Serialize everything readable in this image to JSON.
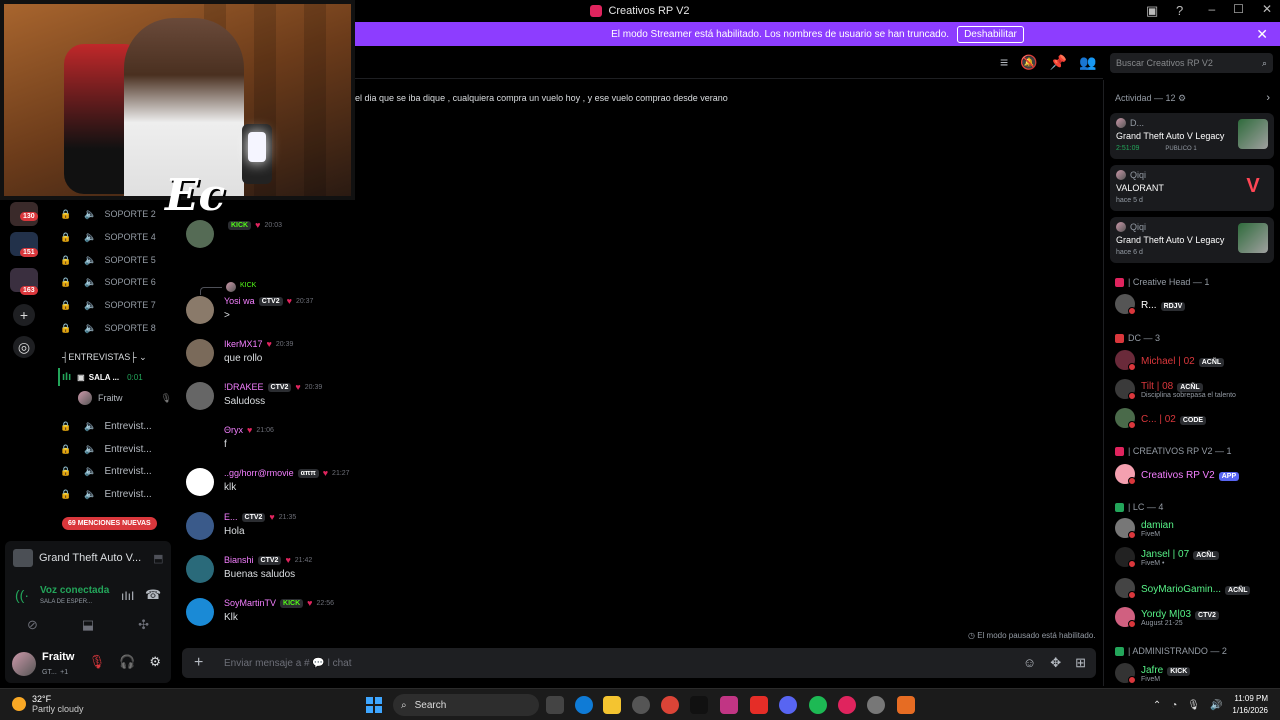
{
  "window": {
    "title": "Creativos RP V2"
  },
  "banner": {
    "text": "El modo Streamer está habilitado. Los nombres de usuario se han truncado.",
    "button": "Deshabilitar"
  },
  "rail": {
    "badges": [
      "130",
      "151",
      "163"
    ]
  },
  "channels": {
    "support": [
      "SOPORTE 2",
      "SOPORTE 4",
      "SOPORTE 5",
      "SOPORTE 6",
      "SOPORTE 7",
      "SOPORTE 8"
    ],
    "category": "ENTREVISTAS",
    "active_voice": "SALA ...",
    "active_voice_time": "0:01",
    "voice_user": "Fraitw",
    "entrevistas": [
      "Entrevist...",
      "Entrevist...",
      "Entrevist...",
      "Entrevist..."
    ],
    "mentions": "69 MENCIONES NUEVAS"
  },
  "user_panel": {
    "game": "Grand Theft Auto V...",
    "voice_status": "Voz conectada",
    "voice_sub": "SALA DE ESPER...",
    "username": "Fraitw",
    "user_status": "GT...",
    "user_extra": "+1"
  },
  "search": {
    "placeholder": "Buscar Creativos RP V2"
  },
  "chat": {
    "top_message": "el dia que se iba dique , cualquiera compra un vuelo hoy , y ese vuelo comprao desde verano",
    "reply_ref": "KICK",
    "messages": [
      {
        "author": "",
        "badge": "KICK",
        "badge_kind": "kick",
        "time": "20:03",
        "text": "",
        "author_color": "#dbdee1"
      },
      {
        "author": "Yosi wa",
        "badge": "CTV2",
        "badge_kind": "ctv2",
        "time": "20:37",
        "text": ">",
        "author_color": "#f47fff"
      },
      {
        "author": "IkerMX17",
        "badge": "",
        "badge_kind": "",
        "time": "20:39",
        "text": "que rollo",
        "author_color": "#f47fff"
      },
      {
        "author": "!DRAKEE",
        "badge": "CTV2",
        "badge_kind": "ctv2",
        "time": "20:39",
        "text": "Saludoss",
        "author_color": "#f47fff"
      },
      {
        "author": "Θryx",
        "badge": "",
        "badge_kind": "",
        "time": "21:06",
        "text": "f",
        "author_color": "#f47fff"
      },
      {
        "author": "..gg/horr@rmovie",
        "badge": "αππ",
        "badge_kind": "",
        "time": "21:27",
        "text": "klk",
        "author_color": "#f47fff"
      },
      {
        "author": "E...",
        "badge": "CTV2",
        "badge_kind": "ctv2",
        "time": "21:35",
        "text": "Hola",
        "author_color": "#f47fff"
      },
      {
        "author": "Bianshi",
        "badge": "CTV2",
        "badge_kind": "ctv2",
        "time": "21:42",
        "text": "Buenas saludos",
        "author_color": "#f47fff"
      },
      {
        "author": "SoyMartinTV",
        "badge": "KICK",
        "badge_kind": "kick",
        "time": "22:56",
        "text": "Klk",
        "author_color": "#f47fff"
      }
    ],
    "slowmode": "El modo pausado está habilitado.",
    "composer_placeholder": "Enviar mensaje a # 💬 l chat"
  },
  "activity": {
    "header": "Actividad — 12",
    "cards": [
      {
        "user": "D...",
        "game": "Grand Theft Auto V Legacy",
        "status": "2:51:09",
        "extra": "PUBLICO 1",
        "status_green": true,
        "icon": "gta"
      },
      {
        "user": "Qiqi",
        "game": "VALORANT",
        "status": "hace 5 d",
        "extra": "",
        "status_green": false,
        "icon": "valorant"
      },
      {
        "user": "Qiqi",
        "game": "Grand Theft Auto V Legacy",
        "status": "hace 6 d",
        "extra": "",
        "status_green": false,
        "icon": "gta"
      }
    ]
  },
  "roles": [
    {
      "name": "| Creative Head — 1",
      "color": "#e0245e"
    },
    {
      "name": "DC — 3",
      "color": "#da373c"
    },
    {
      "name": "| CREATIVOS RP V2 — 1",
      "color": "#e0245e"
    },
    {
      "name": "| LC — 4",
      "color": "#23a55a"
    },
    {
      "name": "| ADMINISTRANDO — 2",
      "color": "#23a55a"
    }
  ],
  "members": [
    {
      "name": "R...",
      "tag": "RDJV",
      "sub": "",
      "color": "#ffffff"
    },
    {
      "name": "Michael | 02",
      "tag": "ACÑL",
      "sub": "",
      "color": "#da373c"
    },
    {
      "name": "Tilt | 08",
      "tag": "ACÑL",
      "sub": "Disciplina sobrepasa el talento",
      "color": "#da373c"
    },
    {
      "name": "C... | 02",
      "tag": "CODE",
      "sub": "",
      "color": "#da373c"
    },
    {
      "name": "Creativos RP V2",
      "tag": "APP",
      "sub": "",
      "color": "#f47fff"
    },
    {
      "name": "damian",
      "tag": "",
      "sub": "FiveM",
      "color": "#57f287"
    },
    {
      "name": "Jansel | 07",
      "tag": "ACÑL",
      "sub": "FiveM •",
      "color": "#57f287"
    },
    {
      "name": "SoyMarioGamin...",
      "tag": "ACÑL",
      "sub": "",
      "color": "#57f287"
    },
    {
      "name": "Yordy M|03",
      "tag": "CTV2",
      "sub": "August 21-25",
      "color": "#57f287"
    },
    {
      "name": "Jafre",
      "tag": "KICK",
      "sub": "FiveM",
      "color": "#57f287"
    }
  ],
  "taskbar": {
    "temp": "32°F",
    "weather": "Partly cloudy",
    "search": "Search",
    "time": "11:09 PM",
    "date": "1/16/2026"
  },
  "overlay": {
    "logo": "Ec"
  }
}
